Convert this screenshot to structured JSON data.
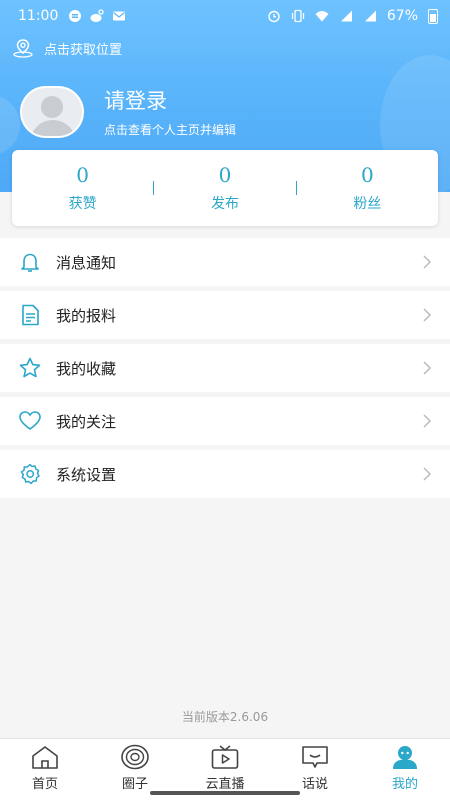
{
  "status_bar": {
    "time": "11:00",
    "battery": "67%"
  },
  "location": {
    "label": "点击获取位置"
  },
  "profile": {
    "login_label": "请登录",
    "subtitle": "点击查看个人主页并编辑"
  },
  "stats": [
    {
      "value": "0",
      "label": "获赞"
    },
    {
      "value": "0",
      "label": "发布"
    },
    {
      "value": "0",
      "label": "粉丝"
    }
  ],
  "menu": [
    {
      "label": "消息通知",
      "icon": "bell-icon"
    },
    {
      "label": "我的报料",
      "icon": "document-icon"
    },
    {
      "label": "我的收藏",
      "icon": "star-icon"
    },
    {
      "label": "我的关注",
      "icon": "heart-icon"
    },
    {
      "label": "系统设置",
      "icon": "gear-icon"
    }
  ],
  "version": "当前版本2.6.06",
  "tabs": [
    {
      "label": "首页",
      "icon": "home-icon"
    },
    {
      "label": "圈子",
      "icon": "circle-icon"
    },
    {
      "label": "云直播",
      "icon": "tv-icon"
    },
    {
      "label": "话说",
      "icon": "chat-icon"
    },
    {
      "label": "我的",
      "icon": "person-icon",
      "active": true
    }
  ],
  "colors": {
    "accent": "#2aa7c9",
    "header_top": "#6ec2ff",
    "header_bottom": "#4ea9f6"
  }
}
